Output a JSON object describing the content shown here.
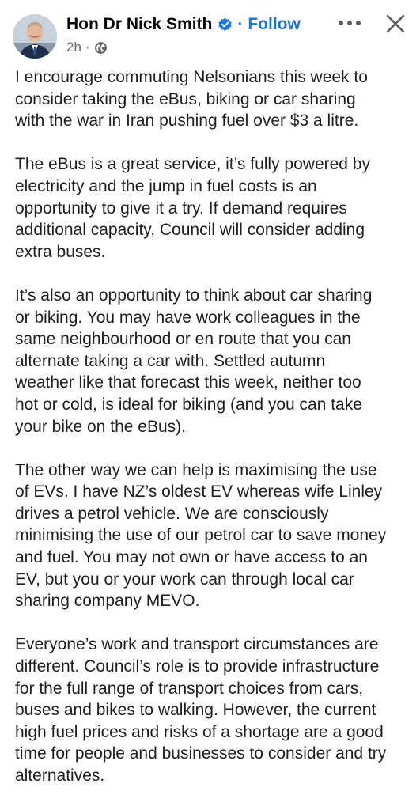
{
  "post": {
    "author": {
      "name": "Hon Dr Nick Smith",
      "verified_icon": "verified-badge-icon",
      "follow_separator": "·",
      "follow_label": "Follow"
    },
    "meta": {
      "time": "2h",
      "separator": "·",
      "audience_icon": "globe-icon"
    },
    "actions": {
      "more_icon": "more-options-icon",
      "close_icon": "close-icon"
    },
    "paragraphs": [
      "I encourage commuting Nelsonians this week to\nconsider taking the eBus, biking or car sharing\nwith the war in Iran pushing fuel over $3 a litre.",
      "The eBus is a great service, it’s fully powered by\nelectricity and the jump in fuel costs is an\nopportunity to give it a try. If demand requires\nadditional capacity, Council will consider adding\nextra buses.",
      "It’s also an opportunity to think about car sharing\nor biking. You may have work colleagues in the\nsame neighbourhood or en route that you can\nalternate taking a car with. Settled autumn\nweather like that forecast this week, neither too\nhot or cold, is ideal for biking (and you can take\nyour bike on the eBus).",
      "The other way we can help is maximising the use\nof EVs. I have NZ’s oldest EV whereas wife Linley\ndrives a petrol vehicle. We are consciously\nminimising the use of our petrol car to save money\nand fuel. You may not own or have access to an\nEV, but you or your work can through local car\nsharing company MEVO.",
      "Everyone’s work and transport circumstances are\ndifferent. Council’s role is to provide infrastructure\nfor the full range of transport choices from cars,\nbuses and bikes to walking. However, the current\nhigh fuel prices and risks of a shortage are a good\ntime for people and businesses to consider and try\nalternatives."
    ]
  },
  "colors": {
    "accent": "#1b74e4",
    "text": "#1c1e21",
    "muted": "#65676b",
    "background": "#ffffff"
  }
}
